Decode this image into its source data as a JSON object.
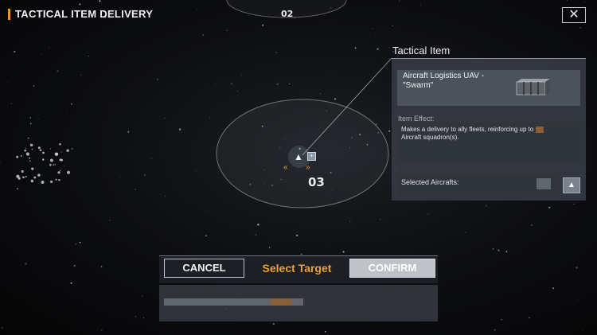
{
  "header": {
    "title": "TACTICAL ITEM DELIVERY",
    "close_icon": "✕"
  },
  "map": {
    "sectors": [
      {
        "label": "02"
      },
      {
        "label": "03"
      }
    ]
  },
  "panel": {
    "title": "Tactical Item",
    "item_name": "Aircraft Logistics UAV - \"Swarm\"",
    "effect_heading": "Item Effect:",
    "effect_text": "Makes a delivery to ally fleets, reinforcing up to",
    "effect_text_2": "Aircraft squadron(s).",
    "selected_label": "Selected Aircrafts:",
    "item_icon": "uav-crate-icon",
    "select_icon": "aircraft-select-icon"
  },
  "actions": {
    "cancel_label": "CANCEL",
    "select_target_label": "Select Target",
    "confirm_label": "CONFIRM"
  },
  "colors": {
    "accent": "#e7a23c",
    "panel_bg": "#363a42",
    "confirm_bg": "#bfc3c8"
  }
}
